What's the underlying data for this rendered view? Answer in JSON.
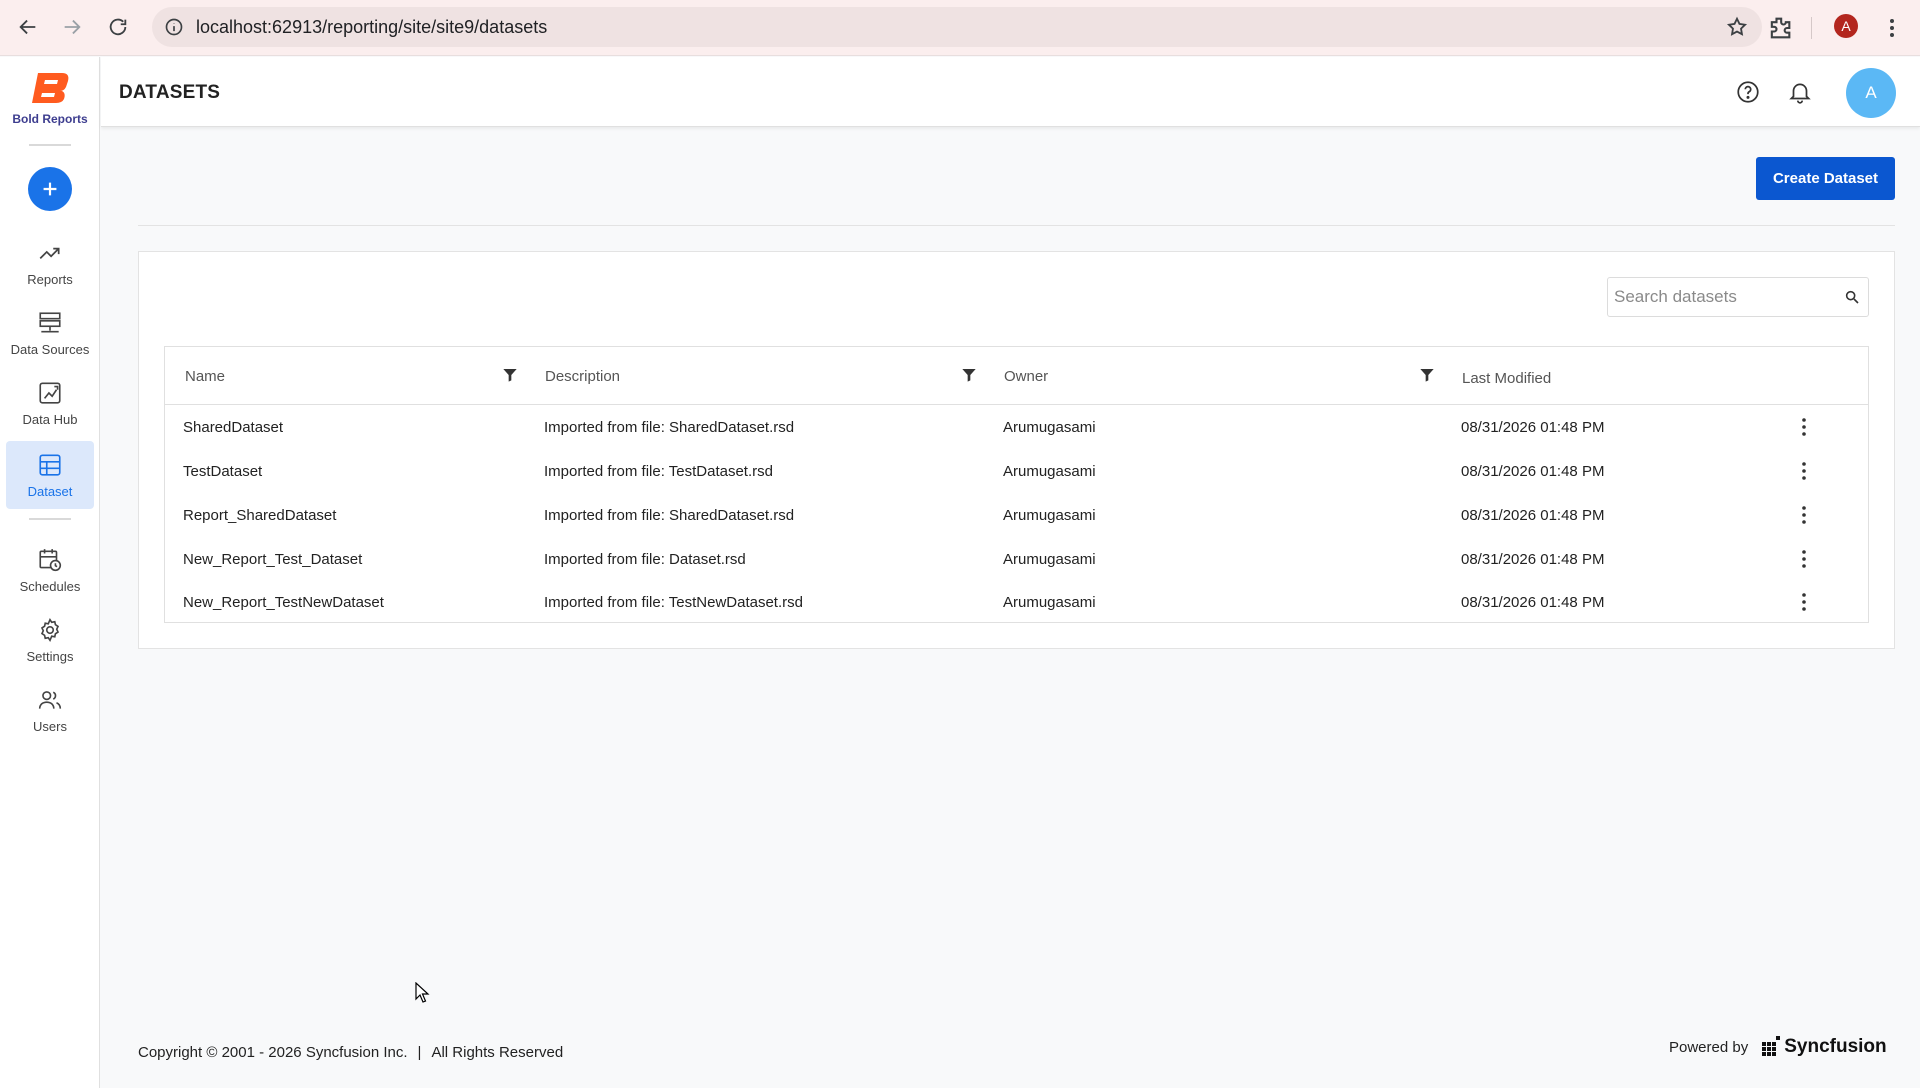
{
  "browser": {
    "url": "localhost:62913/reporting/site/site9/datasets",
    "profile_initial": "A"
  },
  "brand": {
    "name": "Bold Reports",
    "color": "#ff5b1f"
  },
  "sidebar": {
    "items": [
      {
        "label": "Reports",
        "icon": "trending-up-icon"
      },
      {
        "label": "Data Sources",
        "icon": "data-sources-icon"
      },
      {
        "label": "Data Hub",
        "icon": "data-hub-icon"
      },
      {
        "label": "Dataset",
        "icon": "dataset-icon",
        "active": true
      },
      {
        "label": "Schedules",
        "icon": "calendar-clock-icon"
      },
      {
        "label": "Settings",
        "icon": "gear-icon"
      },
      {
        "label": "Users",
        "icon": "users-icon"
      }
    ]
  },
  "header": {
    "title": "DATASETS",
    "avatar_initial": "A"
  },
  "toolbar": {
    "create_label": "Create Dataset"
  },
  "search": {
    "placeholder": "Search datasets"
  },
  "table": {
    "columns": [
      "Name",
      "Description",
      "Owner",
      "Last Modified"
    ],
    "rows": [
      {
        "name": "SharedDataset",
        "description": "Imported from file: SharedDataset.rsd",
        "owner": "Arumugasami",
        "modified": "08/31/2026 01:48 PM"
      },
      {
        "name": "TestDataset",
        "description": "Imported from file: TestDataset.rsd",
        "owner": "Arumugasami",
        "modified": "08/31/2026 01:48 PM"
      },
      {
        "name": "Report_SharedDataset",
        "description": "Imported from file: SharedDataset.rsd",
        "owner": "Arumugasami",
        "modified": "08/31/2026 01:48 PM"
      },
      {
        "name": "New_Report_Test_Dataset",
        "description": "Imported from file: Dataset.rsd",
        "owner": "Arumugasami",
        "modified": "08/31/2026 01:48 PM"
      },
      {
        "name": "New_Report_TestNewDataset",
        "description": "Imported from file: TestNewDataset.rsd",
        "owner": "Arumugasami",
        "modified": "08/31/2026 01:48 PM"
      }
    ]
  },
  "footer": {
    "copyright": "Copyright © 2001 - 2026 Syncfusion Inc.",
    "separator": "|",
    "rights": "All Rights Reserved",
    "powered_by": "Powered by",
    "vendor": "Syncfusion"
  },
  "colors": {
    "accent": "#0b57d0",
    "active_bg": "#dce8fb",
    "avatar": "#5bb8f5"
  }
}
